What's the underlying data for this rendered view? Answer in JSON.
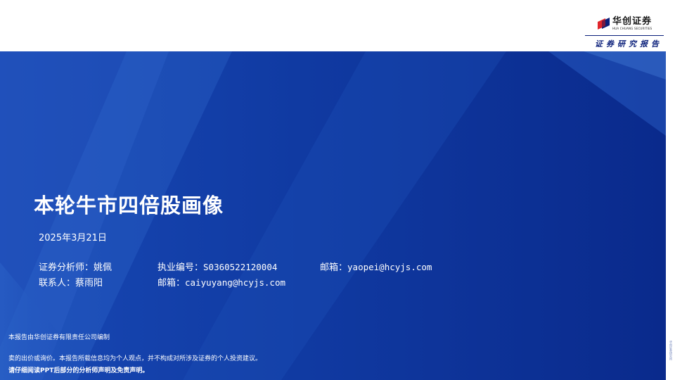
{
  "header": {
    "logo_name": "华创证券",
    "logo_en": "HUA CHUANG SECURITIES",
    "report_type": "证券研究报告"
  },
  "colors": {
    "brand_navy": "#0a1f7a",
    "banner_blue": "#103aa2",
    "logo_red": "#e0262c"
  },
  "main": {
    "title": "本轮牛市四倍股画像",
    "date": "2025年3月21日",
    "analyst_label": "证券分析师：姚佩",
    "license_label": "执业编号：",
    "license_no": "S0360522120004",
    "email1_label": "邮箱：",
    "email1": "yaopei@hcyjs.com",
    "contact_label": "联系人：蔡雨阳",
    "email2_label": "邮箱：",
    "email2": "caiyuyang@hcyjs.com"
  },
  "footer": {
    "compiled": "本报告由华创证券有限责任公司编制",
    "disclaimer1": "卖的出价或询价。本报告所载信息均为个人观点，并不构成对所涉及证券的个人投资建议。",
    "disclaimer2": "请仔细阅读PPT后部分的分析师声明及免责声明。"
  },
  "side": {
    "text": "华创证券研究所"
  }
}
